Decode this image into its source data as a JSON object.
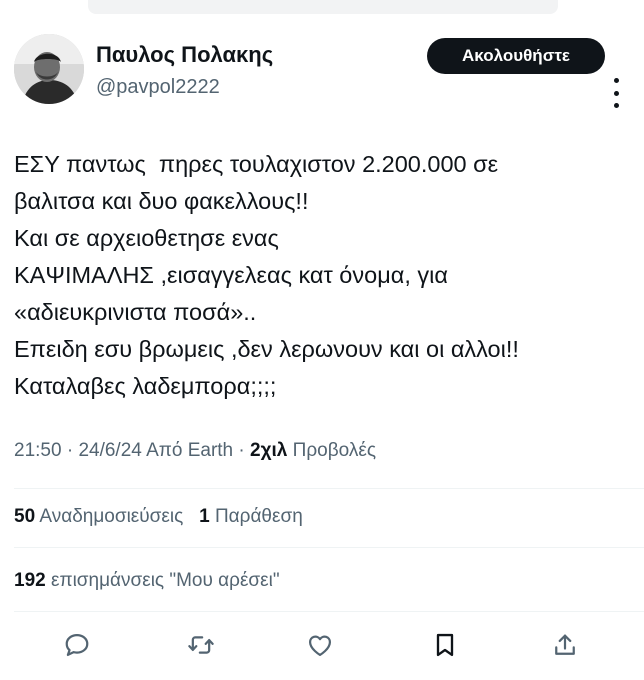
{
  "author": {
    "name": "Παυλος Πολακης",
    "handle": "@pavpol2222"
  },
  "follow_label": "Ακολουθήστε",
  "tweet": {
    "lines": [
      "ΕΣΥ παντως  πηρες τουλαχιστον 2.200.000 σε",
      "βαλιτσα και δυο φακελλους!!",
      "Και σε αρχειοθετησε ενας",
      "ΚΑΨΙΜΑΛΗΣ ,εισαγγελεας κατ όνομα, για",
      "«αδιευκρινιστα ποσά»..",
      "Επειδη εσυ βρωμεις ,δεν λερωνουν και οι αλλοι!!",
      "Καταλαβες λαδεμπορα;;;;"
    ]
  },
  "meta": {
    "time": "21:50",
    "date": "24/6/24",
    "source": "Από Earth",
    "views_count": "2χιλ",
    "views_label": "Προβολές"
  },
  "stats": {
    "reposts_count": "50",
    "reposts_label": "Αναδημοσιεύσεις",
    "quotes_count": "1",
    "quotes_label": "Παράθεση",
    "likes_count": "192",
    "likes_label": "επισημάνσεις \"Μου αρέσει\""
  },
  "actions": [
    "reply-icon",
    "retweet-icon",
    "like-icon",
    "bookmark-icon",
    "share-icon"
  ],
  "colors": {
    "text": "#0f1419",
    "secondary": "#536471",
    "divider": "#eff3f4",
    "button": "#0f1419"
  }
}
